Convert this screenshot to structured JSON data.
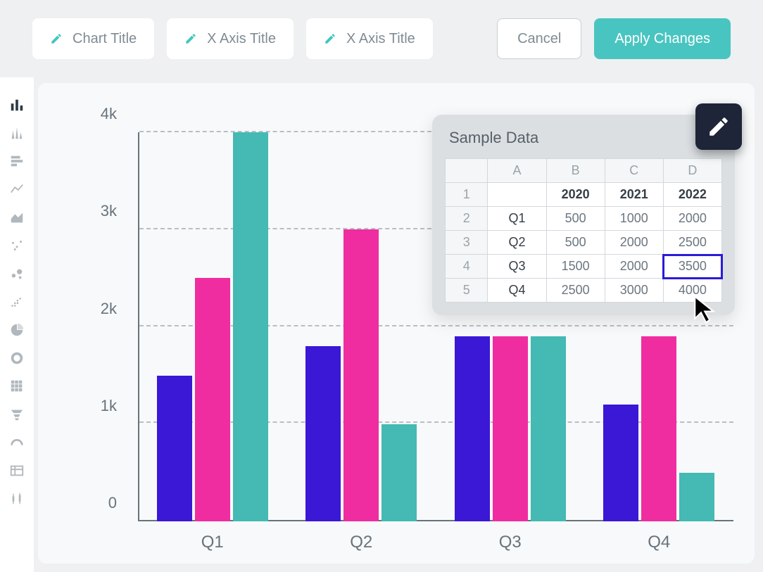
{
  "toolbar": {
    "chart_title_label": "Chart Title",
    "x_axis_title_label_1": "X Axis Title",
    "x_axis_title_label_2": "X Axis Title",
    "cancel_label": "Cancel",
    "apply_label": "Apply Changes"
  },
  "chart": {
    "y_ticks": [
      "0",
      "1k",
      "2k",
      "3k",
      "4k"
    ],
    "x_labels": [
      "Q1",
      "Q2",
      "Q3",
      "Q4"
    ]
  },
  "panel": {
    "title": "Sample Data",
    "col_headers": [
      "A",
      "B",
      "C",
      "D"
    ],
    "row_headers": [
      "1",
      "2",
      "3",
      "4",
      "5"
    ],
    "rows": [
      [
        "",
        "2020",
        "2021",
        "2022"
      ],
      [
        "Q1",
        "500",
        "1000",
        "2000"
      ],
      [
        "Q2",
        "500",
        "2000",
        "2500"
      ],
      [
        "Q3",
        "1500",
        "2000",
        "3500"
      ],
      [
        "Q4",
        "2500",
        "3000",
        "4000"
      ]
    ],
    "selected_cell": "3500"
  },
  "chart_data": {
    "type": "bar",
    "categories": [
      "Q1",
      "Q2",
      "Q3",
      "Q4"
    ],
    "series": [
      {
        "name": "2020",
        "color": "#3b17d6",
        "values": [
          1500,
          1800,
          1900,
          1200
        ]
      },
      {
        "name": "2021",
        "color": "#ef2da0",
        "values": [
          2500,
          3000,
          1900,
          1900
        ]
      },
      {
        "name": "2022",
        "color": "#45b9b3",
        "values": [
          4000,
          1000,
          1900,
          500
        ]
      }
    ],
    "ylim": [
      0,
      4000
    ],
    "y_tick_labels": [
      "0",
      "1k",
      "2k",
      "3k",
      "4k"
    ],
    "xlabel": "",
    "ylabel": "",
    "title": ""
  },
  "colors": {
    "accent": "#49c5c1",
    "series2020": "#3b17d6",
    "series2021": "#ef2da0",
    "series2022": "#45b9b3"
  }
}
